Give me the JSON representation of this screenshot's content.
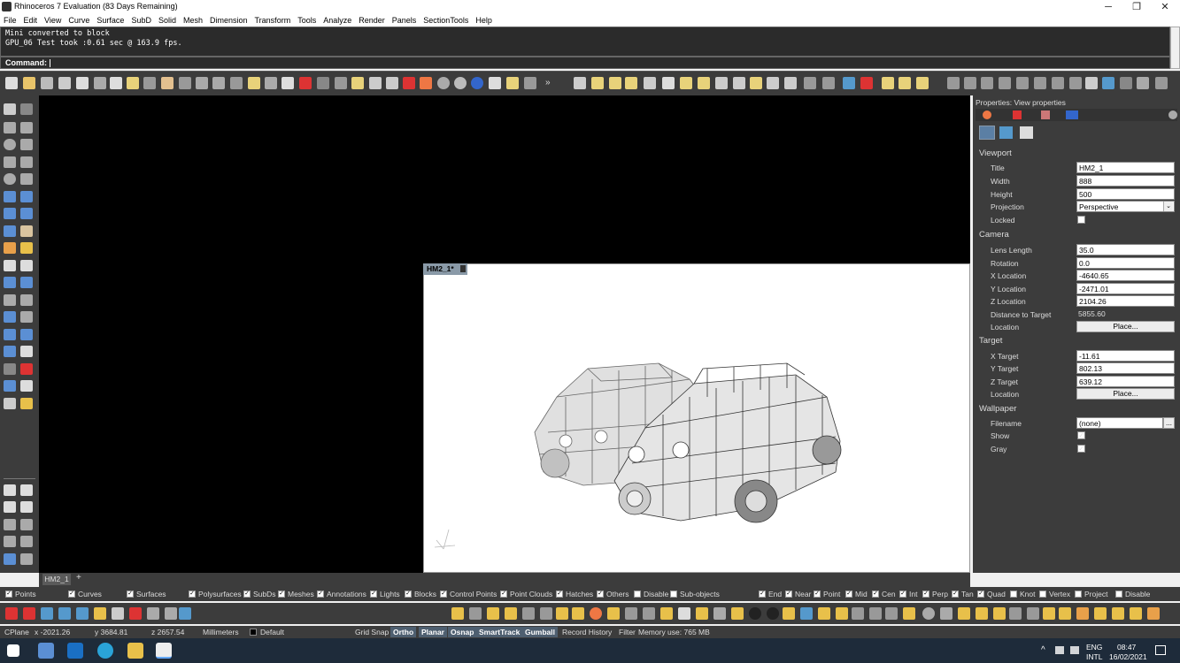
{
  "window": {
    "title": "Rhinoceros 7 Evaluation (83 Days Remaining)",
    "min_icon": "minimize-icon",
    "max_icon": "maximize-icon",
    "close_icon": "close-icon",
    "min_glyph": "─",
    "max_glyph": "❐",
    "close_glyph": "✕"
  },
  "menu": [
    "File",
    "Edit",
    "View",
    "Curve",
    "Surface",
    "SubD",
    "Solid",
    "Mesh",
    "Dimension",
    "Transform",
    "Tools",
    "Analyze",
    "Render",
    "Panels",
    "SectionTools",
    "Help"
  ],
  "command": {
    "history": [
      "Mini converted to block",
      "GPU_06 Test took :0.61 sec @ 163.9 fps."
    ],
    "prompt": "Command:"
  },
  "viewport": {
    "tab_label": "HM2_1*"
  },
  "properties": {
    "header": "Properties: View properties",
    "sections": {
      "viewport": "Viewport",
      "camera": "Camera",
      "target": "Target",
      "wallpaper": "Wallpaper"
    },
    "fields": {
      "title": {
        "label": "Title",
        "value": "HM2_1"
      },
      "width": {
        "label": "Width",
        "value": "888"
      },
      "height": {
        "label": "Height",
        "value": "500"
      },
      "projection": {
        "label": "Projection",
        "value": "Perspective"
      },
      "locked": {
        "label": "Locked",
        "checked": false
      },
      "lens_length": {
        "label": "Lens Length",
        "value": "35.0"
      },
      "rotation": {
        "label": "Rotation",
        "value": "0.0"
      },
      "x_location": {
        "label": "X Location",
        "value": "-4640.65"
      },
      "y_location": {
        "label": "Y Location",
        "value": "-2471.01"
      },
      "z_location": {
        "label": "Z Location",
        "value": "2104.26"
      },
      "distance": {
        "label": "Distance to Target",
        "value": "5855.60"
      },
      "cam_location": {
        "label": "Location",
        "button": "Place..."
      },
      "x_target": {
        "label": "X Target",
        "value": "-11.61"
      },
      "y_target": {
        "label": "Y Target",
        "value": "802.13"
      },
      "z_target": {
        "label": "Z Target",
        "value": "639.12"
      },
      "tgt_location": {
        "label": "Location",
        "button": "Place..."
      },
      "filename": {
        "label": "Filename",
        "value": "(none)",
        "button": "..."
      },
      "show": {
        "label": "Show",
        "checked": true
      },
      "gray": {
        "label": "Gray",
        "checked": true
      }
    }
  },
  "layout_tabs": {
    "active": "HM2_1",
    "add": "+"
  },
  "selection_filter": [
    {
      "label": "Points",
      "checked": true
    },
    {
      "label": "Curves",
      "checked": true
    },
    {
      "label": "Surfaces",
      "checked": true
    },
    {
      "label": "Polysurfaces",
      "checked": true
    },
    {
      "label": "SubDs",
      "checked": true
    },
    {
      "label": "Meshes",
      "checked": true
    },
    {
      "label": "Annotations",
      "checked": true
    },
    {
      "label": "Lights",
      "checked": true
    },
    {
      "label": "Blocks",
      "checked": true
    },
    {
      "label": "Control Points",
      "checked": true
    },
    {
      "label": "Point Clouds",
      "checked": true
    },
    {
      "label": "Hatches",
      "checked": true
    },
    {
      "label": "Others",
      "checked": true
    },
    {
      "label": "Disable",
      "checked": false
    },
    {
      "label": "Sub-objects",
      "checked": false
    }
  ],
  "osnaps": [
    {
      "label": "End",
      "checked": true
    },
    {
      "label": "Near",
      "checked": true
    },
    {
      "label": "Point",
      "checked": true
    },
    {
      "label": "Mid",
      "checked": true
    },
    {
      "label": "Cen",
      "checked": true
    },
    {
      "label": "Int",
      "checked": true
    },
    {
      "label": "Perp",
      "checked": true
    },
    {
      "label": "Tan",
      "checked": true
    },
    {
      "label": "Quad",
      "checked": true
    },
    {
      "label": "Knot",
      "checked": false
    },
    {
      "label": "Vertex",
      "checked": false
    },
    {
      "label": "Project",
      "checked": false
    },
    {
      "label": "Disable",
      "checked": false
    }
  ],
  "status": {
    "cplane": "CPlane",
    "x": "x -2021.26",
    "y": "y 3684.81",
    "z": "z 2657.54",
    "units": "Millimeters",
    "layer": "Default",
    "grid_snap": "Grid Snap",
    "ortho": "Ortho",
    "planar": "Planar",
    "osnap": "Osnap",
    "smarttrack": "SmartTrack",
    "gumball": "Gumball",
    "record_history": "Record History",
    "filter": "Filter",
    "memory": "Memory use: 765 MB"
  },
  "taskbar": {
    "lang": "ENG",
    "region": "INTL",
    "time": "08:47",
    "date": "16/02/2021"
  }
}
